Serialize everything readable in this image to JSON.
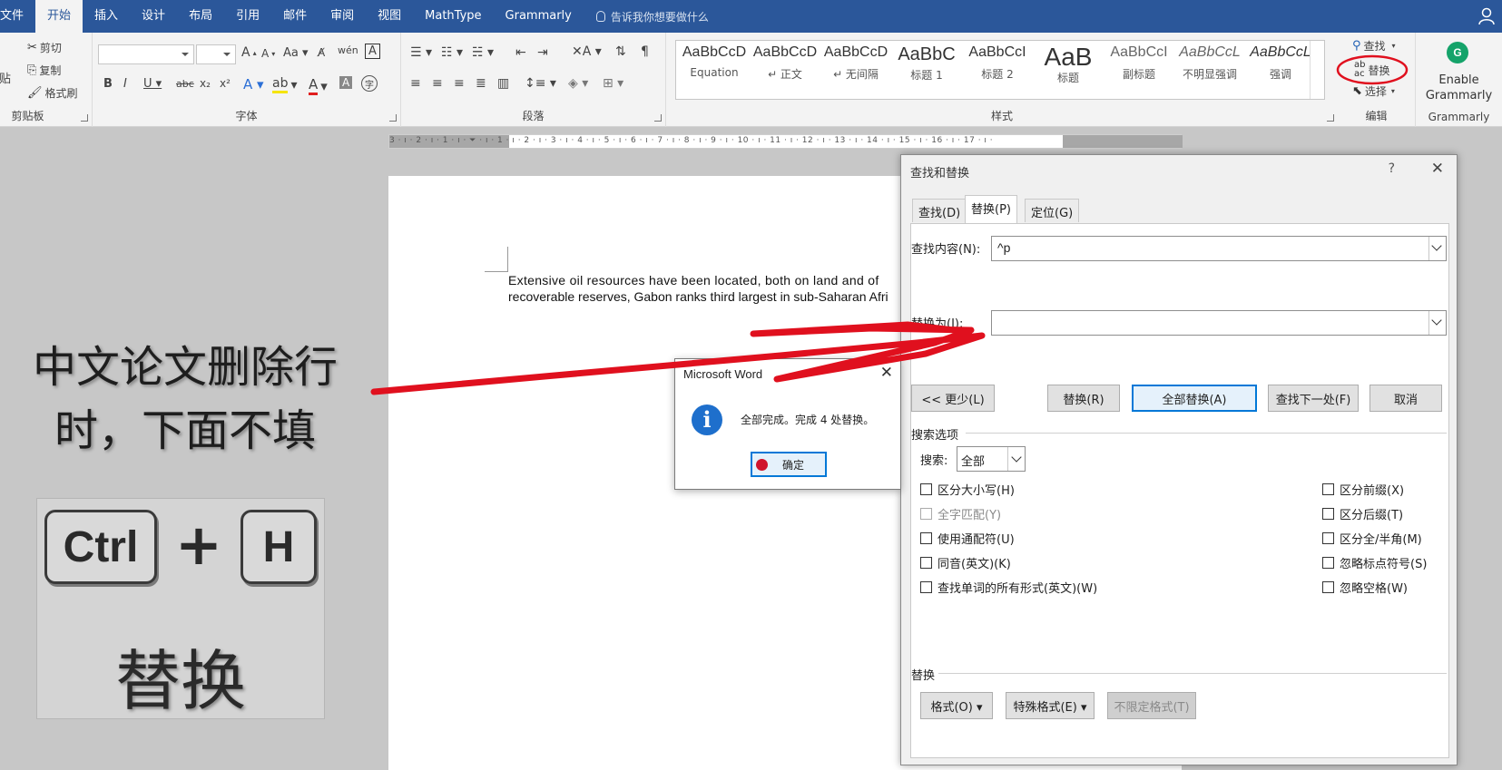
{
  "menubar": {
    "tabs": [
      "文件",
      "开始",
      "插入",
      "设计",
      "布局",
      "引用",
      "邮件",
      "审阅",
      "视图",
      "MathType",
      "Grammarly"
    ],
    "active_tab": "开始",
    "tell_me": "告诉我你想要做什么"
  },
  "ribbon": {
    "clipboard": {
      "paste": "粘贴",
      "cut": "剪切",
      "copy": "复制",
      "format_painter": "格式刷",
      "label": "剪贴板"
    },
    "font": {
      "label": "字体",
      "name_value": "",
      "size_value": ""
    },
    "paragraph": {
      "label": "段落"
    },
    "styles": {
      "label": "样式",
      "items": [
        {
          "sample": "AaBbCcD",
          "name": "Equation"
        },
        {
          "sample": "AaBbCcD",
          "name": "↵ 正文"
        },
        {
          "sample": "AaBbCcD",
          "name": "↵ 无间隔"
        },
        {
          "sample": "AaBbC",
          "name": "标题 1"
        },
        {
          "sample": "AaBbCcI",
          "name": "标题 2"
        },
        {
          "sample": "AaB",
          "name": "标题"
        },
        {
          "sample": "AaBbCcI",
          "name": "副标题"
        },
        {
          "sample": "AaBbCcL",
          "name": "不明显强调"
        },
        {
          "sample": "AaBbCcL",
          "name": "强调"
        }
      ]
    },
    "editing": {
      "find": "查找",
      "replace": "替换",
      "select": "选择",
      "label": "编辑"
    },
    "grammarly": {
      "enable": "Enable",
      "name": "Grammarly",
      "label": "Grammarly"
    }
  },
  "ruler": {
    "text": "3 · ı · 2 · ı · 1 · ı · ⏷ · ı · 1 · ı · 2 · ı · 3 · ı · 4 · ı · 5 · ı · 6 · ı · 7 · ı · 8 · ı · 9 · ı · 10 · ı · 11 · ı · 12 · ı · 13 · ı · 14 · ı · 15 · ı · 16 · ı · 17 · ı ·"
  },
  "document": {
    "line1": "Extensive oil resources have been located, both on land and of",
    "line2": "recoverable reserves, Gabon ranks third largest in sub-Saharan Afri"
  },
  "overlay": {
    "caption_line1": "中文论文删除行",
    "caption_line2": "时，下面不填",
    "key1": "Ctrl",
    "plus": "+",
    "key2": "H",
    "action": "替换"
  },
  "find_replace": {
    "title": "查找和替换",
    "help": "?",
    "tabs": [
      "查找(D)",
      "替换(P)",
      "定位(G)"
    ],
    "find_label": "查找内容(N):",
    "find_value": "^p",
    "replace_label": "替换为(I):",
    "replace_value": "",
    "buttons": {
      "less": "<< 更少(L)",
      "replace": "替换(R)",
      "replace_all": "全部替换(A)",
      "find_next": "查找下一处(F)",
      "cancel": "取消"
    },
    "search_options_title": "搜索选项",
    "search_label": "搜索:",
    "search_value": "全部",
    "options_left": [
      "区分大小写(H)",
      "全字匹配(Y)",
      "使用通配符(U)",
      "同音(英文)(K)",
      "查找单词的所有形式(英文)(W)"
    ],
    "options_right": [
      "区分前缀(X)",
      "区分后缀(T)",
      "区分全/半角(M)",
      "忽略标点符号(S)",
      "忽略空格(W)"
    ],
    "replace_section_title": "替换",
    "format_btn": "格式(O) ▾",
    "special_btn": "特殊格式(E) ▾",
    "no_format_btn": "不限定格式(T)"
  },
  "msgbox": {
    "title": "Microsoft Word",
    "icon": "i",
    "text": "全部完成。完成 4 处替换。",
    "ok": "确定"
  },
  "colors": {
    "accent": "#2b579a",
    "annotation": "#e0101e",
    "focus": "#0078d7"
  }
}
